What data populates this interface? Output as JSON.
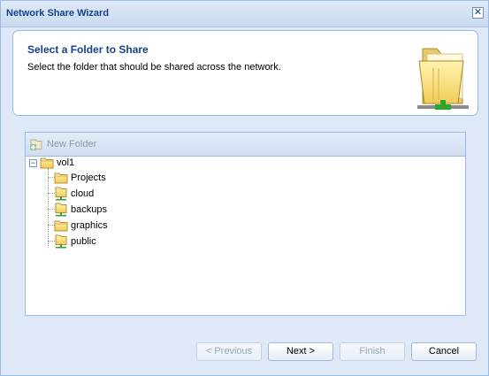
{
  "window": {
    "title": "Network Share Wizard",
    "close_glyph": "✕"
  },
  "header": {
    "title": "Select a Folder to Share",
    "description": "Select the folder that should be shared across the network.",
    "icon": "shared-folder-icon"
  },
  "toolbar": {
    "new_folder_label": "New Folder",
    "new_folder_icon": "new-folder-icon",
    "new_folder_enabled": false
  },
  "tree": {
    "root": {
      "label": "vol1",
      "expanded": true,
      "expander_glyph": "−"
    },
    "children": [
      {
        "label": "Projects",
        "shared": false
      },
      {
        "label": "cloud",
        "shared": true
      },
      {
        "label": "backups",
        "shared": true
      },
      {
        "label": "graphics",
        "shared": false
      },
      {
        "label": "public",
        "shared": true
      }
    ]
  },
  "buttons": {
    "previous": {
      "label": "< Previous",
      "enabled": false
    },
    "next": {
      "label": "Next >",
      "enabled": true
    },
    "finish": {
      "label": "Finish",
      "enabled": false
    },
    "cancel": {
      "label": "Cancel",
      "enabled": true
    }
  },
  "colors": {
    "accent": "#15428b",
    "border": "#99bbe8",
    "background": "#dfe8f6"
  }
}
